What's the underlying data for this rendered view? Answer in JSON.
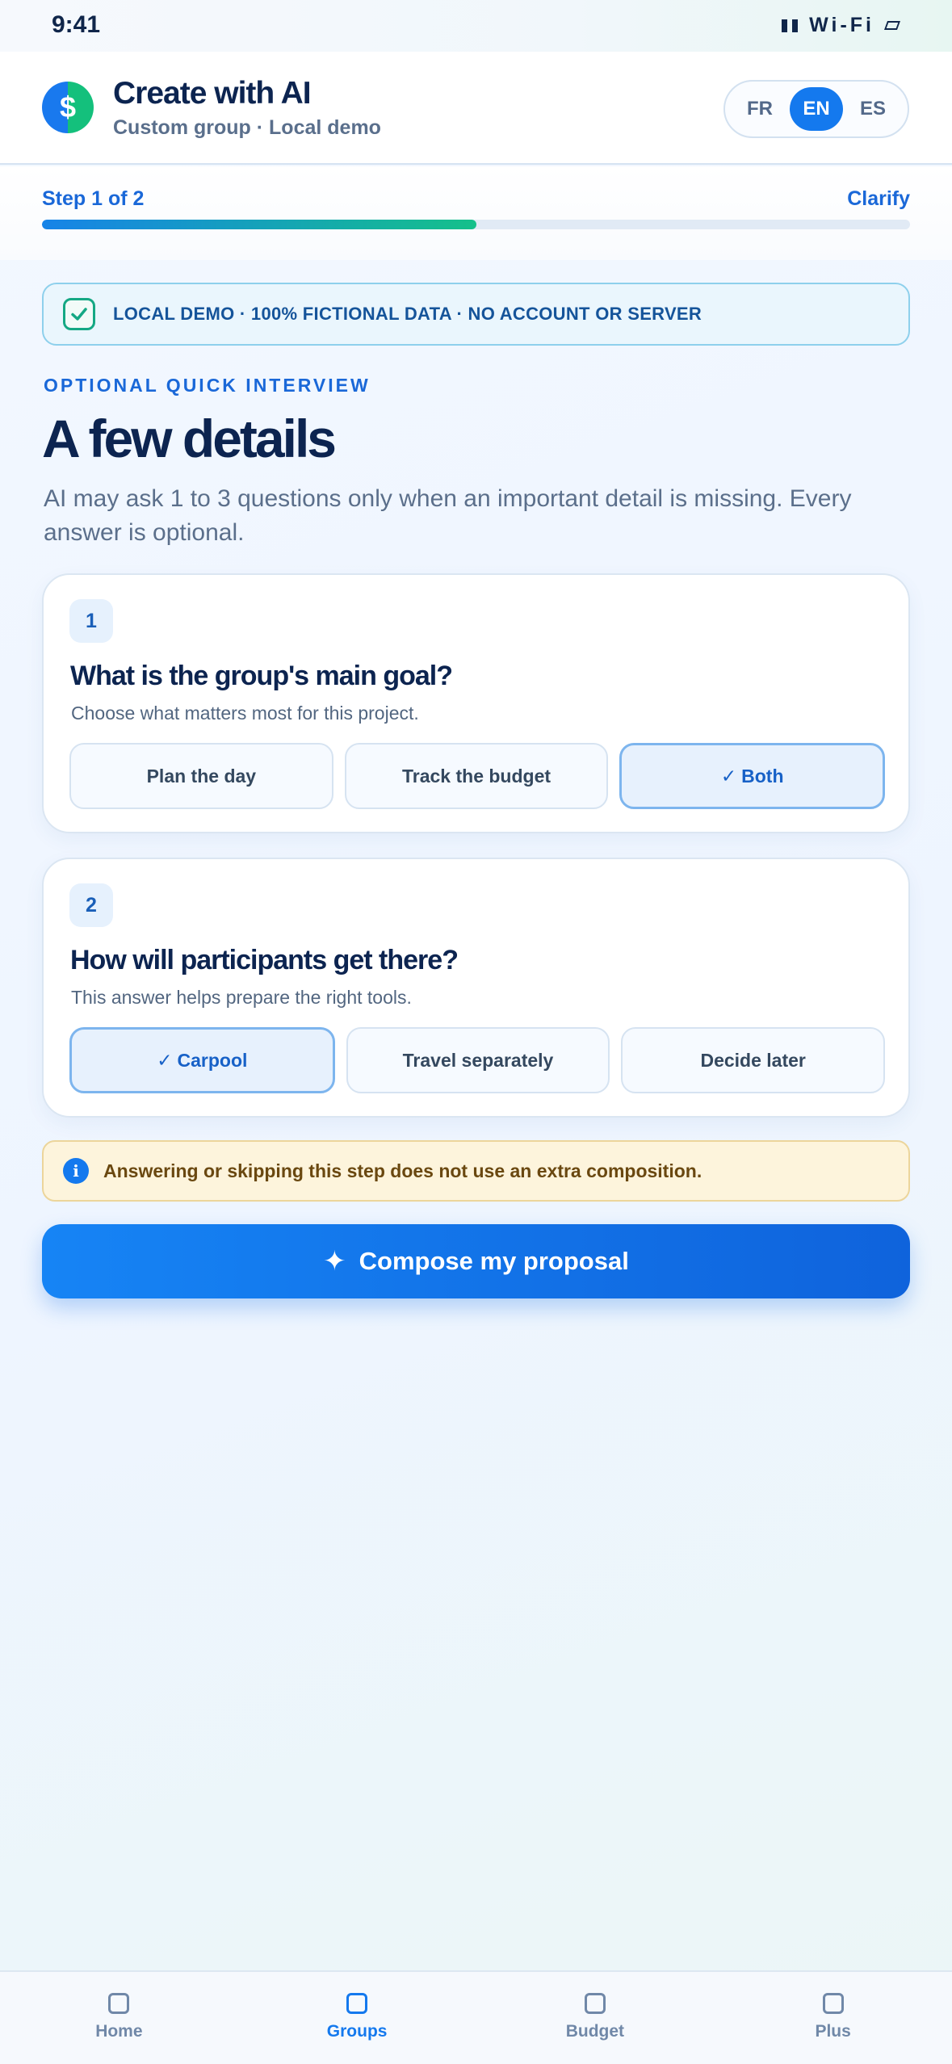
{
  "status_bar": {
    "time": "9:41",
    "wifi": "Wi-Fi"
  },
  "header": {
    "logo_glyph": "$",
    "title": "Create with AI",
    "subtitle": "Custom group · Local demo",
    "languages": [
      {
        "code": "FR",
        "active": false
      },
      {
        "code": "EN",
        "active": true
      },
      {
        "code": "ES",
        "active": false
      }
    ]
  },
  "progress": {
    "step_label": "Step 1 of 2",
    "step_name": "Clarify",
    "percent": 50
  },
  "demo_banner": {
    "text": "LOCAL DEMO · 100% FICTIONAL DATA · NO ACCOUNT OR SERVER"
  },
  "intro": {
    "eyebrow": "OPTIONAL QUICK INTERVIEW",
    "title": "A few details",
    "description": "AI may ask 1 to 3 questions only when an important detail is missing. Every answer is optional."
  },
  "questions": [
    {
      "number": "1",
      "title": "What is the group's main goal?",
      "hint": "Choose what matters most for this project.",
      "options": [
        "Plan the day",
        "Track the budget",
        "Both"
      ],
      "selected_index": 2
    },
    {
      "number": "2",
      "title": "How will participants get there?",
      "hint": "This answer helps prepare the right tools.",
      "options": [
        "Carpool",
        "Travel separately",
        "Decide later"
      ],
      "selected_index": 0
    }
  ],
  "notice": {
    "icon": "i",
    "text": "Answering or skipping this step does not use an extra composition."
  },
  "primary_action": {
    "icon": "✦",
    "label": "Compose my proposal"
  },
  "bottom_nav": {
    "items": [
      {
        "label": "Home",
        "active": false
      },
      {
        "label": "Groups",
        "active": true
      },
      {
        "label": "Budget",
        "active": false
      },
      {
        "label": "Plus",
        "active": false
      }
    ]
  },
  "colors": {
    "accent": "#1479ee",
    "success": "#14c08a",
    "text_dark": "#0c2450",
    "notice_bg": "#fdf4dc"
  }
}
